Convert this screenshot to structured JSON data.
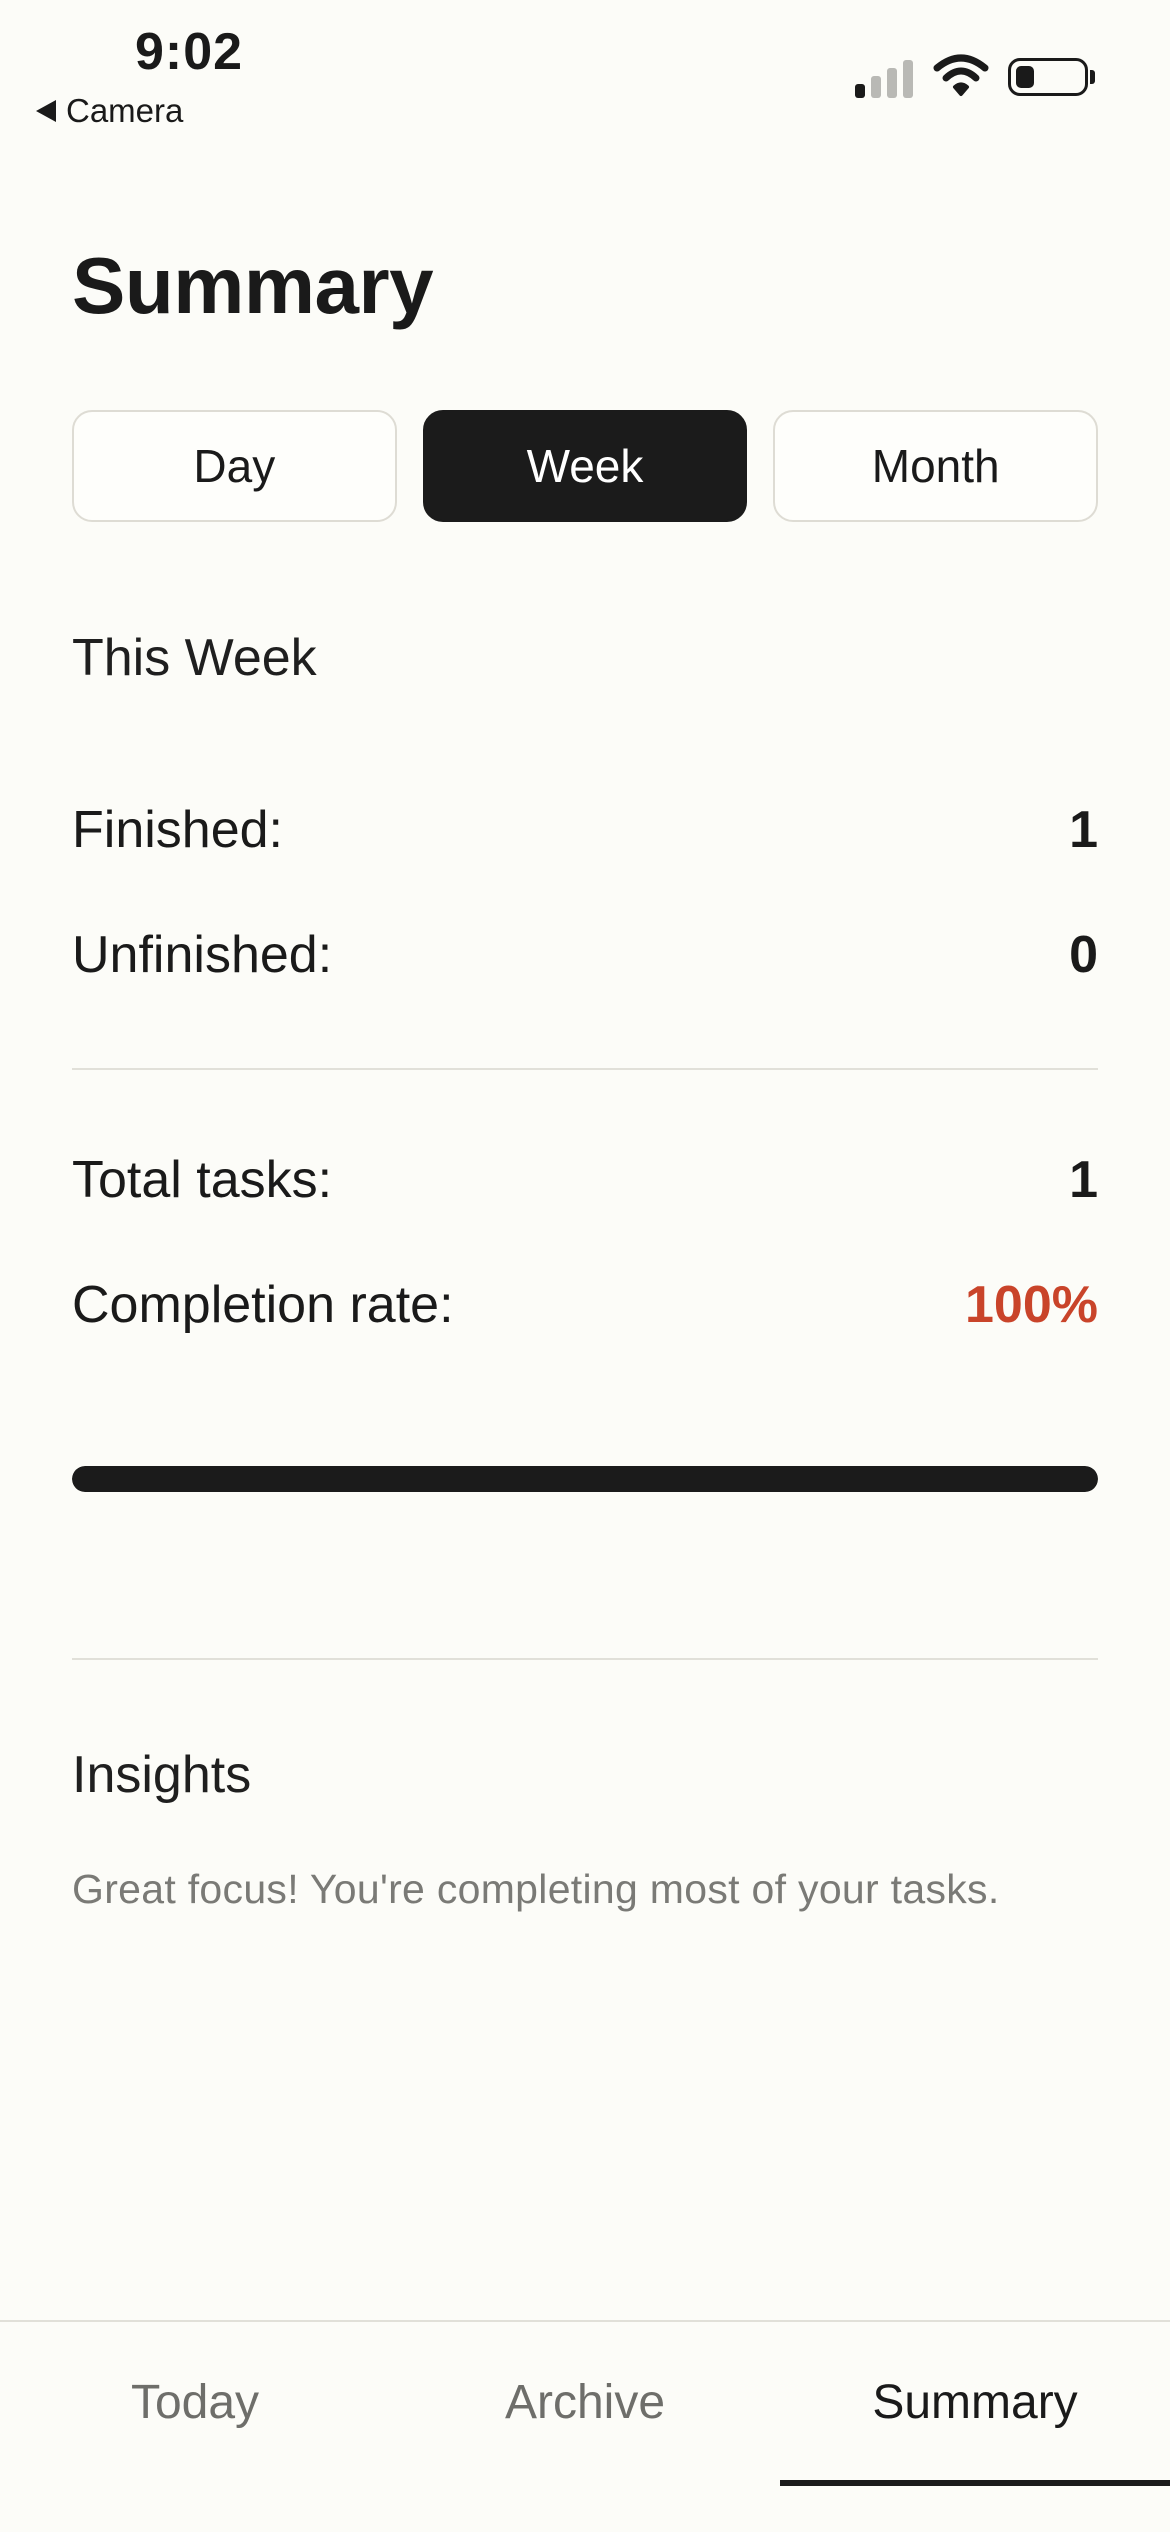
{
  "status_bar": {
    "time": "9:02",
    "back_label": "Camera",
    "icons": [
      "signal-icon",
      "wifi-icon",
      "battery-icon"
    ]
  },
  "page_title": "Summary",
  "segments": [
    {
      "label": "Day",
      "active": false
    },
    {
      "label": "Week",
      "active": true
    },
    {
      "label": "Month",
      "active": false
    }
  ],
  "period_label": "This Week",
  "stats": {
    "finished_label": "Finished:",
    "finished_value": "1",
    "unfinished_label": "Unfinished:",
    "unfinished_value": "0",
    "total_label": "Total tasks:",
    "total_value": "1",
    "rate_label": "Completion rate:",
    "rate_value": "100%"
  },
  "progress": {
    "fraction": 1.0
  },
  "insights": {
    "title": "Insights",
    "text": "Great focus! You're completing most of your tasks."
  },
  "tabs": [
    {
      "label": "Today",
      "active": false
    },
    {
      "label": "Archive",
      "active": false
    },
    {
      "label": "Summary",
      "active": true
    }
  ],
  "colors": {
    "accent": "#c9442a",
    "dark": "#1b1b1b",
    "background": "#fcfcf8"
  }
}
